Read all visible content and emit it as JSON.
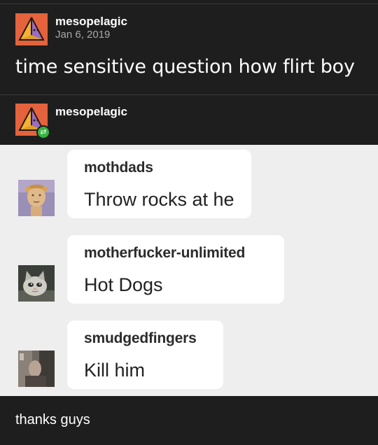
{
  "post": {
    "author": "mesopelagic",
    "date": "Jan 6, 2019",
    "text": "time sensitive question how flirt boy"
  },
  "reblog": {
    "author": "mesopelagic",
    "icon": "reblog-icon",
    "badge_color": "#34b33e"
  },
  "replies": [
    {
      "username": "mothdads",
      "text": "Throw rocks at he",
      "avatar": "statue-avatar"
    },
    {
      "username": "motherfucker-unlimited",
      "text": "Hot Dogs",
      "avatar": "cat-avatar"
    },
    {
      "username": "smudgedfingers",
      "text": "Kill him",
      "avatar": "photo-avatar"
    }
  ],
  "footer": {
    "text": "thanks guys"
  },
  "colors": {
    "background": "#1e1e1e",
    "avatar": "#e4633c",
    "reply_area": "#eeeeee",
    "bubble": "#ffffff"
  }
}
